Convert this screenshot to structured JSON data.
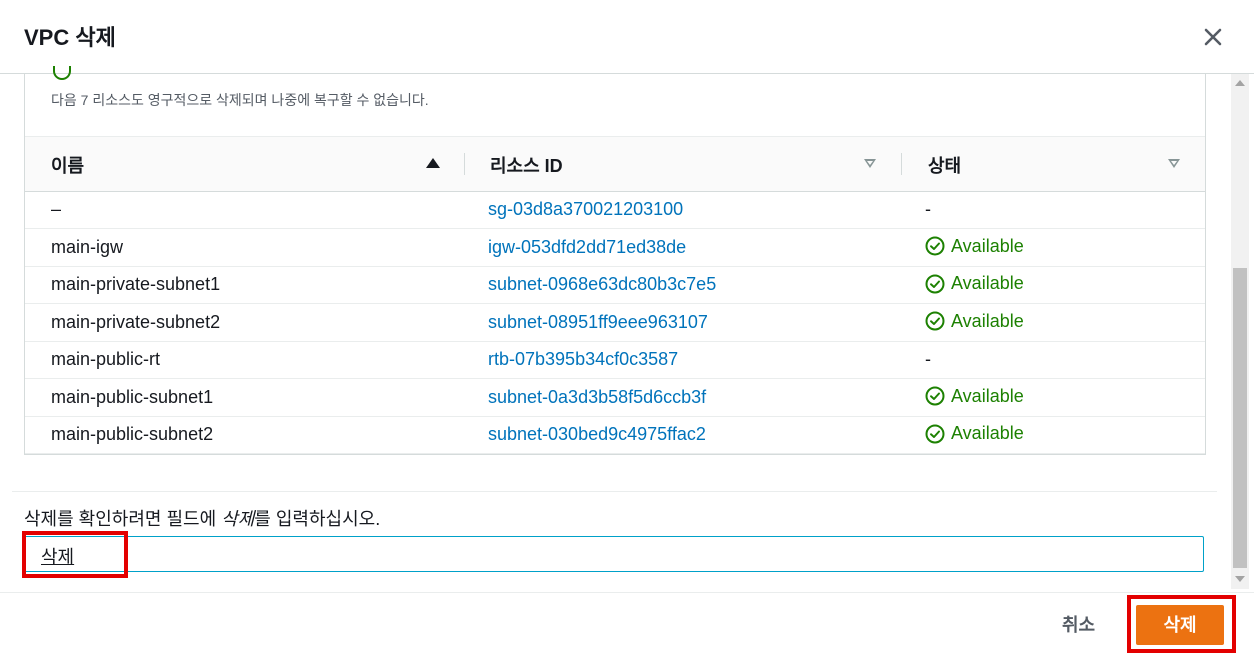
{
  "modal": {
    "title": "VPC 삭제",
    "description": "다음 7 리소스도 영구적으로 삭제되며 나중에 복구할 수 없습니다."
  },
  "table": {
    "columns": [
      "이름",
      "리소스 ID",
      "상태"
    ],
    "rows": [
      {
        "name": "–",
        "id": "sg-03d8a370021203100",
        "status": "-"
      },
      {
        "name": "main-igw",
        "id": "igw-053dfd2dd71ed38de",
        "status": "Available"
      },
      {
        "name": "main-private-subnet1",
        "id": "subnet-0968e63dc80b3c7e5",
        "status": "Available"
      },
      {
        "name": "main-private-subnet2",
        "id": "subnet-08951ff9eee963107",
        "status": "Available"
      },
      {
        "name": "main-public-rt",
        "id": "rtb-07b395b34cf0c3587",
        "status": "-"
      },
      {
        "name": "main-public-subnet1",
        "id": "subnet-0a3d3b58f5d6ccb3f",
        "status": "Available"
      },
      {
        "name": "main-public-subnet2",
        "id": "subnet-030bed9c4975ffac2",
        "status": "Available"
      }
    ]
  },
  "confirm": {
    "label_prefix": "삭제를 확인하려면 필드에 ",
    "label_keyword": "삭제",
    "label_suffix": "를 입력하십시오.",
    "input_value": "삭제"
  },
  "footer": {
    "cancel_label": "취소",
    "delete_label": "삭제"
  },
  "colors": {
    "accent": "#ec7211",
    "link": "#0073bb",
    "success": "#1d8102",
    "highlight": "#e30000"
  }
}
